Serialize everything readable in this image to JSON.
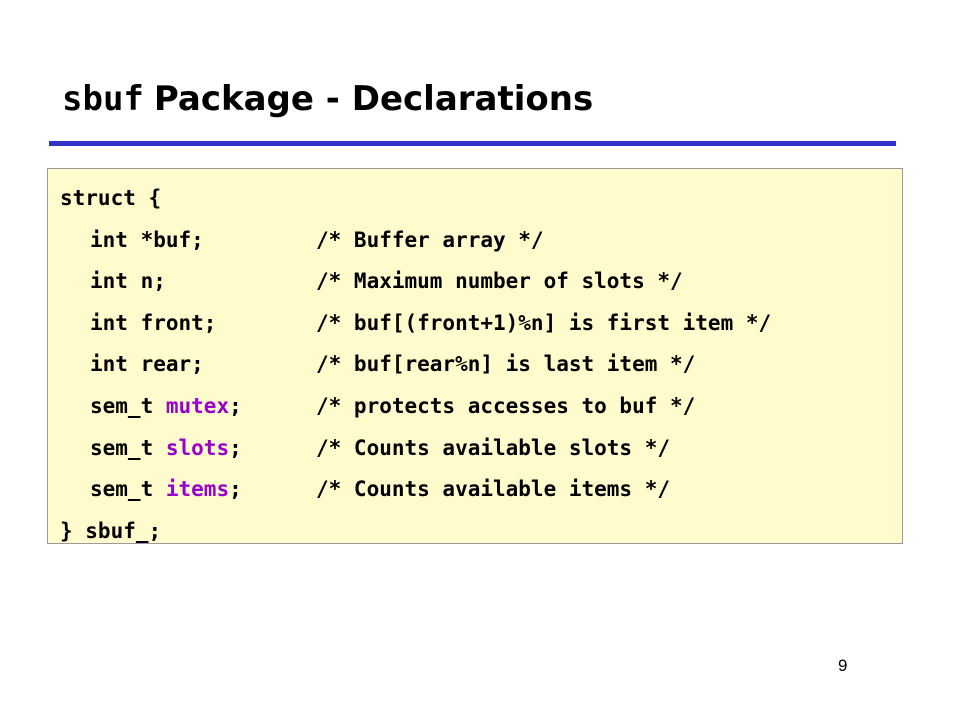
{
  "slide": {
    "title_code": "sbuf",
    "title_text": "Package - Declarations",
    "page_number": "9"
  },
  "code": {
    "open": "struct {",
    "fields": [
      {
        "type": "int",
        "name": "*buf;",
        "comment": "/* Buffer array */"
      },
      {
        "type": "int",
        "name": "n;",
        "comment": "/* Maximum number of slots */"
      },
      {
        "type": "int",
        "name": "front;",
        "comment": "/* buf[(front+1)%n] is first item */"
      },
      {
        "type": "int",
        "name": "rear;",
        "comment": "/* buf[rear%n] is last item */"
      },
      {
        "type": "sem_t",
        "name": "mutex",
        "suffix": ";",
        "comment": "/* protects accesses to buf */"
      },
      {
        "type": "sem_t",
        "name": "slots",
        "suffix": ";",
        "comment": "/* Counts available slots */"
      },
      {
        "type": "sem_t",
        "name": "items",
        "suffix": ";",
        "comment": "/* Counts available items */"
      }
    ],
    "close": "} sbuf_;"
  },
  "colors": {
    "rule": "#3333cc",
    "code_background": "#fffbcc",
    "highlight": "#9900cc"
  }
}
